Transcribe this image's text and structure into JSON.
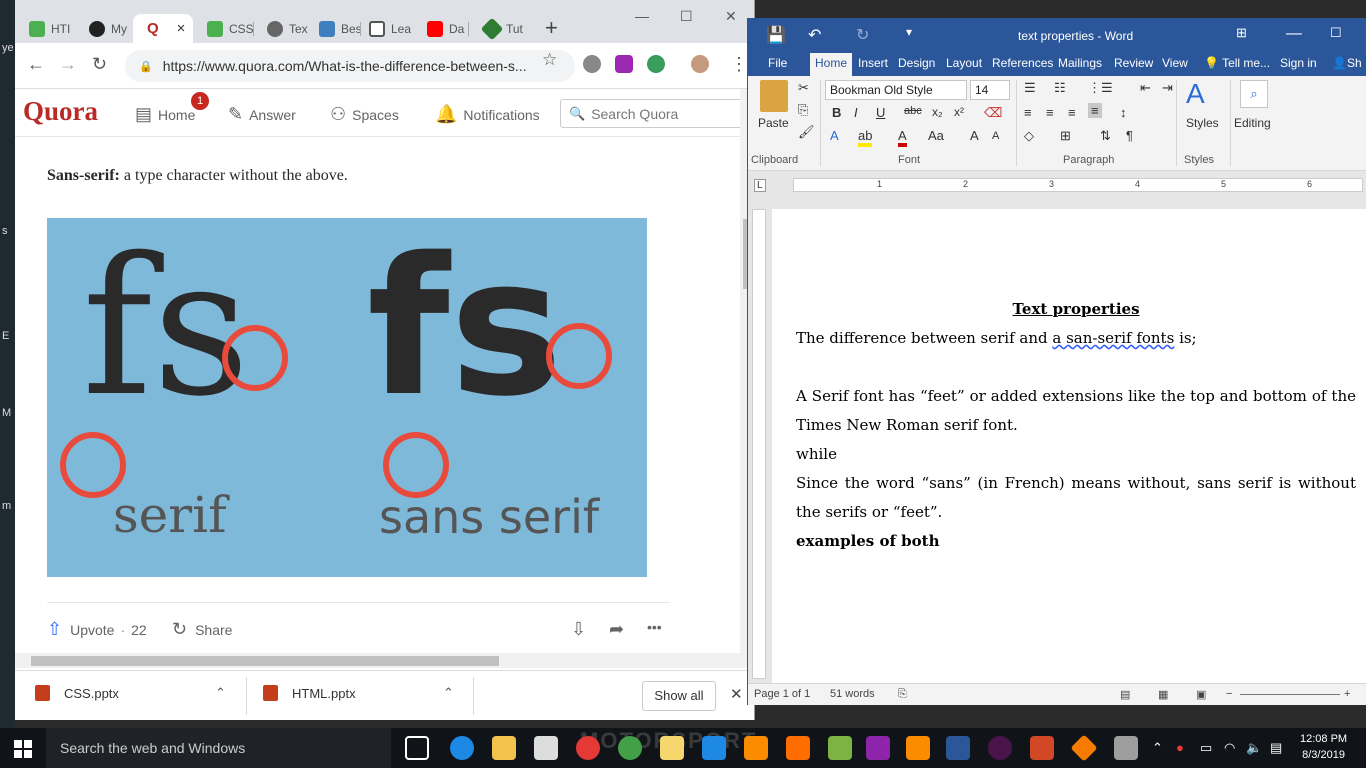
{
  "desktop": {
    "left_letters": [
      "ye",
      "s",
      "E",
      "M",
      "m"
    ]
  },
  "chrome": {
    "tabs": [
      {
        "label": "HTI",
        "color": "#4caf50"
      },
      {
        "label": "My",
        "color": "#222222"
      },
      {
        "label": "Q",
        "color": "#b92b27"
      },
      {
        "label": "CSS",
        "color": "#4caf50"
      },
      {
        "label": "Tex",
        "color": "#666666"
      },
      {
        "label": "Bes",
        "color": "#3f7fbf"
      },
      {
        "label": "Lea",
        "color": "#555555"
      },
      {
        "label": "Da",
        "color": "#ff0000"
      },
      {
        "label": "Tut",
        "color": "#2e7d32"
      }
    ],
    "close_tab": "×",
    "new_tab": "+",
    "url": "https://www.quora.com/What-is-the-difference-between-s...",
    "back": "←",
    "forward": "→",
    "reload": "↻",
    "star": "☆",
    "menu": "⋮",
    "min": "—",
    "max": "☐",
    "close": "✕"
  },
  "quora": {
    "logo": "Quora",
    "nav": {
      "home": "Home",
      "answer": "Answer",
      "spaces": "Spaces",
      "notifications": "Notifications"
    },
    "badge": "1",
    "search_placeholder": "Search Quora",
    "content": {
      "bold_lead": "Sans-serif:",
      "text": " a type character without the above.",
      "image": {
        "serif_glyph": "fs",
        "sans_glyph": "fs",
        "serif_caption": "serif",
        "sans_caption": "sans serif"
      },
      "upvote_label": "Upvote",
      "upvote_count": "22",
      "share_label": "Share",
      "more": "•••"
    }
  },
  "downloads": {
    "items": [
      {
        "name": "CSS.pptx"
      },
      {
        "name": "HTML.pptx"
      }
    ],
    "show_all": "Show all",
    "close": "✕"
  },
  "word": {
    "title": "text properties - Word",
    "tabs": [
      "File",
      "Home",
      "Insert",
      "Design",
      "Layout",
      "References",
      "Mailings",
      "Review",
      "View",
      "Tell me...",
      "Sign in",
      "Sh"
    ],
    "font_name": "Bookman Old Style",
    "font_size": "14",
    "groups": {
      "clipboard": "Clipboard",
      "font": "Font",
      "paragraph": "Paragraph",
      "styles": "Styles"
    },
    "paste": "Paste",
    "styles_label": "Styles",
    "editing_label": "Editing",
    "ruler": [
      "1",
      "2",
      "3",
      "4",
      "5",
      "6"
    ],
    "doc": {
      "title": "Text properties",
      "p1_a": "The difference between serif and ",
      "p1_b": "a san-serif fonts",
      "p1_c": " is;",
      "p2": "A Serif font has “feet” or added extensions like the top and bottom of the Times New Roman serif font.",
      "p2b": "while",
      "p3": " Since the word “sans” (in French) means without, sans serif is without the serifs or “feet”.",
      "p4": "examples of both"
    },
    "status": {
      "page": "Page 1 of 1",
      "words": "51 words"
    }
  },
  "taskbar": {
    "search": "Search the web and Windows",
    "time": "12:08 PM",
    "date": "8/3/2019",
    "bg_text": "MOTORSPORT"
  }
}
